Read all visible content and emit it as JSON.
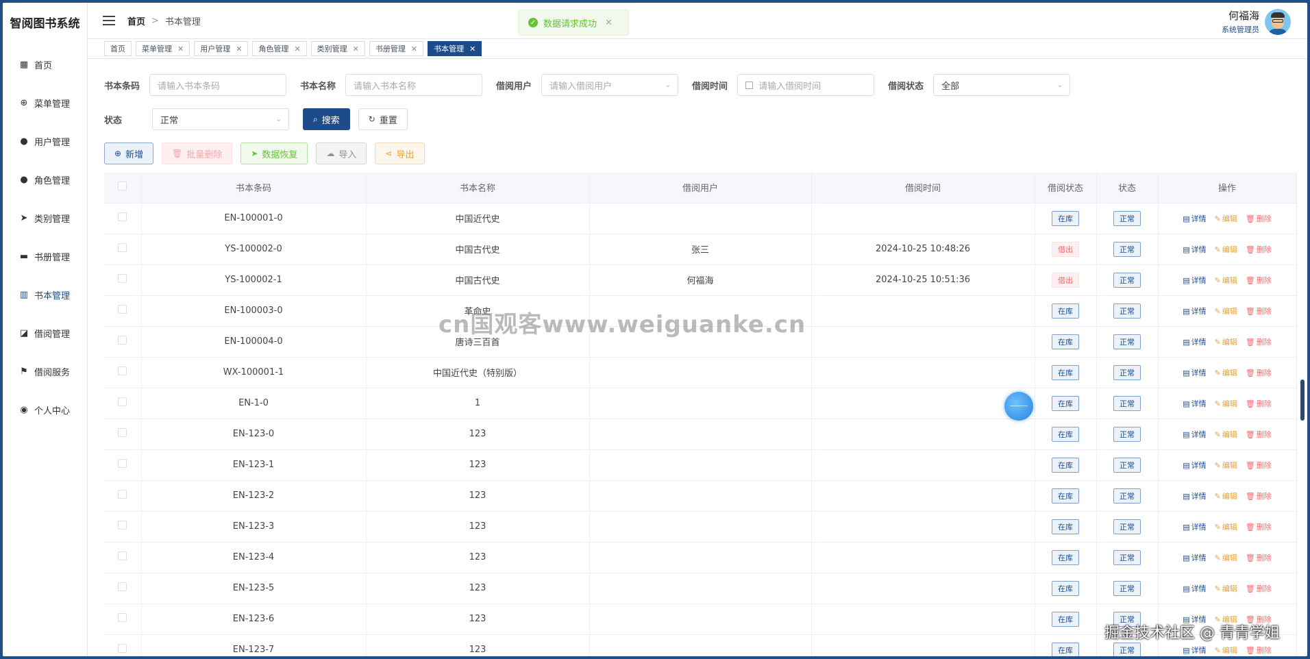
{
  "app": {
    "title": "智阅图书系统"
  },
  "sidebar": {
    "items": [
      {
        "label": "首页",
        "icon": "grid-icon"
      },
      {
        "label": "菜单管理",
        "icon": "plus-circle-icon"
      },
      {
        "label": "用户管理",
        "icon": "user-icon"
      },
      {
        "label": "角色管理",
        "icon": "user-icon"
      },
      {
        "label": "类别管理",
        "icon": "send-icon"
      },
      {
        "label": "书册管理",
        "icon": "monitor-icon"
      },
      {
        "label": "书本管理",
        "icon": "book-icon",
        "active": true
      },
      {
        "label": "借阅管理",
        "icon": "chart-icon"
      },
      {
        "label": "借阅服务",
        "icon": "flag-icon"
      },
      {
        "label": "个人中心",
        "icon": "location-icon"
      }
    ]
  },
  "header": {
    "breadcrumb_home": "首页",
    "breadcrumb_sep": ">",
    "breadcrumb_current": "书本管理",
    "toast": "数据请求成功",
    "user_name": "何福海",
    "user_role": "系统管理员"
  },
  "tags": [
    {
      "label": "首页",
      "closable": false
    },
    {
      "label": "菜单管理",
      "closable": true
    },
    {
      "label": "用户管理",
      "closable": true
    },
    {
      "label": "角色管理",
      "closable": true
    },
    {
      "label": "类别管理",
      "closable": true
    },
    {
      "label": "书册管理",
      "closable": true
    },
    {
      "label": "书本管理",
      "closable": true,
      "active": true
    }
  ],
  "search": {
    "barcode_label": "书本条码",
    "barcode_placeholder": "请输入书本条码",
    "name_label": "书本名称",
    "name_placeholder": "请输入书本名称",
    "borrower_label": "借阅用户",
    "borrower_placeholder": "请输入借阅用户",
    "time_label": "借阅时间",
    "time_placeholder": "请输入借阅时间",
    "borrow_status_label": "借阅状态",
    "borrow_status_value": "全部",
    "status_label": "状态",
    "status_value": "正常",
    "search_button": "搜索",
    "reset_button": "重置"
  },
  "toolbar": {
    "add": "新增",
    "batch_delete": "批量删除",
    "restore": "数据恢复",
    "import": "导入",
    "export": "导出"
  },
  "table": {
    "headers": [
      "书本条码",
      "书本名称",
      "借阅用户",
      "借阅时间",
      "借阅状态",
      "状态",
      "操作"
    ],
    "ops": {
      "detail": "详情",
      "edit": "编辑",
      "delete": "删除"
    },
    "rows": [
      {
        "barcode": "EN-100001-0",
        "name": "中国近代史",
        "borrower": "",
        "time": "",
        "borrow_status": "在库",
        "status": "正常"
      },
      {
        "barcode": "YS-100002-0",
        "name": "中国古代史",
        "borrower": "张三",
        "time": "2024-10-25 10:48:26",
        "borrow_status": "借出",
        "status": "正常"
      },
      {
        "barcode": "YS-100002-1",
        "name": "中国古代史",
        "borrower": "何福海",
        "time": "2024-10-25 10:51:36",
        "borrow_status": "借出",
        "status": "正常"
      },
      {
        "barcode": "EN-100003-0",
        "name": "革命史",
        "borrower": "",
        "time": "",
        "borrow_status": "在库",
        "status": "正常"
      },
      {
        "barcode": "EN-100004-0",
        "name": "唐诗三百首",
        "borrower": "",
        "time": "",
        "borrow_status": "在库",
        "status": "正常"
      },
      {
        "barcode": "WX-100001-1",
        "name": "中国近代史（特别版）",
        "borrower": "",
        "time": "",
        "borrow_status": "在库",
        "status": "正常"
      },
      {
        "barcode": "EN-1-0",
        "name": "1",
        "borrower": "",
        "time": "",
        "borrow_status": "在库",
        "status": "正常"
      },
      {
        "barcode": "EN-123-0",
        "name": "123",
        "borrower": "",
        "time": "",
        "borrow_status": "在库",
        "status": "正常"
      },
      {
        "barcode": "EN-123-1",
        "name": "123",
        "borrower": "",
        "time": "",
        "borrow_status": "在库",
        "status": "正常"
      },
      {
        "barcode": "EN-123-2",
        "name": "123",
        "borrower": "",
        "time": "",
        "borrow_status": "在库",
        "status": "正常"
      },
      {
        "barcode": "EN-123-3",
        "name": "123",
        "borrower": "",
        "time": "",
        "borrow_status": "在库",
        "status": "正常"
      },
      {
        "barcode": "EN-123-4",
        "name": "123",
        "borrower": "",
        "time": "",
        "borrow_status": "在库",
        "status": "正常"
      },
      {
        "barcode": "EN-123-5",
        "name": "123",
        "borrower": "",
        "time": "",
        "borrow_status": "在库",
        "status": "正常"
      },
      {
        "barcode": "EN-123-6",
        "name": "123",
        "borrower": "",
        "time": "",
        "borrow_status": "在库",
        "status": "正常"
      },
      {
        "barcode": "EN-123-7",
        "name": "123",
        "borrower": "",
        "time": "",
        "borrow_status": "在库",
        "status": "正常"
      }
    ]
  },
  "watermark": "cn国观客www.weiguanke.cn",
  "corner_watermark": "掘金技术社区 @ 青青学姐",
  "colors": {
    "primary": "#1e4c8a",
    "success": "#67c23a",
    "danger": "#f56c6c",
    "warning": "#e6a23c"
  }
}
